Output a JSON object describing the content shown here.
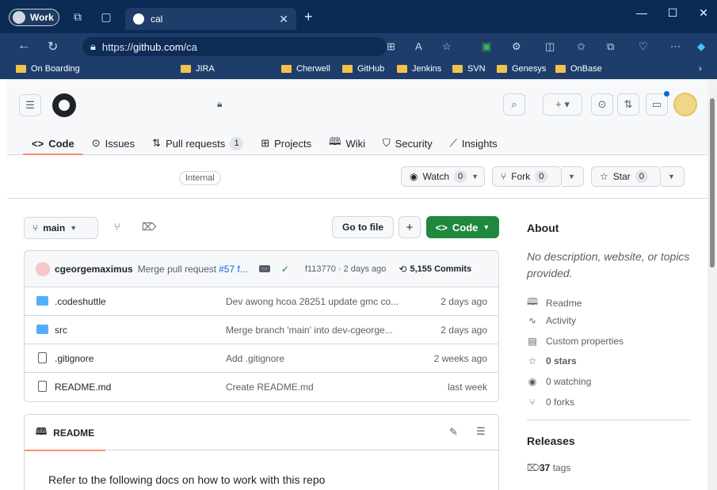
{
  "browser": {
    "profile_label": "Work",
    "tab_title": "cal",
    "url_prefix": "https://",
    "url_host": "github.com",
    "url_path": "/ca",
    "bookmarks": [
      "On Boarding",
      "JIRA",
      "Cherwell",
      "GitHub",
      "Jenkins",
      "SVN",
      "Genesys",
      "OnBase"
    ]
  },
  "repo": {
    "visibility": "Internal",
    "tabs": [
      {
        "label": "Code"
      },
      {
        "label": "Issues"
      },
      {
        "label": "Pull requests",
        "count": "1"
      },
      {
        "label": "Projects"
      },
      {
        "label": "Wiki"
      },
      {
        "label": "Security"
      },
      {
        "label": "Insights"
      }
    ],
    "watch": {
      "label": "Watch",
      "count": "0"
    },
    "fork": {
      "label": "Fork",
      "count": "0"
    },
    "star": {
      "label": "Star",
      "count": "0"
    },
    "branch": "main",
    "goto_file": "Go to file",
    "add": "+",
    "code_button": "Code"
  },
  "commit": {
    "author": "cgeorgemaximus",
    "message": "Merge pull request",
    "pr_link": "#57 f...",
    "sha_time": "f113770 · 2 days ago",
    "commits": "5,155 Commits"
  },
  "files": [
    {
      "name": ".codeshuttle",
      "type": "dir",
      "message": "Dev awong hcoa 28251 update gmc co...",
      "date": "2 days ago"
    },
    {
      "name": "src",
      "type": "dir",
      "message": "Merge branch 'main' into dev-cgeorge...",
      "date": "2 days ago"
    },
    {
      "name": ".gitignore",
      "type": "file",
      "message": "Add .gitignore",
      "date": "2 weeks ago"
    },
    {
      "name": "README.md",
      "type": "file",
      "message": "Create README.md",
      "date": "last week"
    }
  ],
  "readme": {
    "title": "README",
    "text": "Refer to the following docs on how to work with this repo"
  },
  "about": {
    "title": "About",
    "description": "No description, website, or topics provided.",
    "links": [
      "Readme",
      "Activity",
      "Custom properties",
      "0 stars",
      "0 watching",
      "0 forks"
    ],
    "releases_title": "Releases",
    "tags": "37",
    "tags_label": "tags"
  },
  "colors": {
    "accent_green": "#1f883d",
    "tab_underline": "#fd8c73",
    "chrome_dark": "#0b2a54"
  }
}
